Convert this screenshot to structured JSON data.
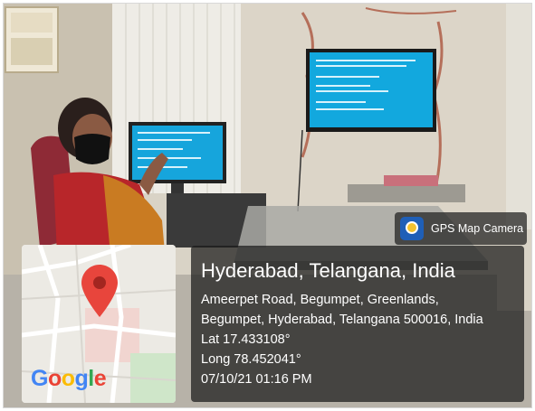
{
  "overlay": {
    "badge_label": "GPS Map Camera",
    "location_title": "Hyderabad, Telangana, India",
    "address_line1": "Ameerpet Road, Begumpet, Greenlands,",
    "address_line2": "Begumpet, Hyderabad, Telangana 500016, India",
    "latitude": "Lat 17.433108°",
    "longitude": "Long 78.452041°",
    "datetime": "07/10/21 01:16 PM"
  },
  "map": {
    "logo_letters": [
      "G",
      "o",
      "o",
      "g",
      "l",
      "e"
    ],
    "logo_colors": [
      "#4285F4",
      "#EA4335",
      "#FBBC05",
      "#4285F4",
      "#34A853",
      "#EA4335"
    ],
    "pin_color": "#e8453c"
  }
}
